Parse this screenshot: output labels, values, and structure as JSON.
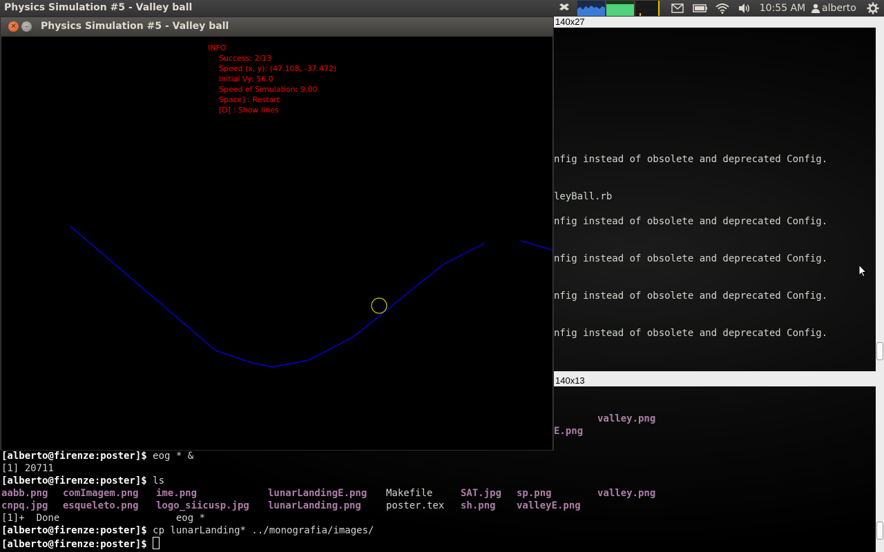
{
  "panel": {
    "app_title": "Physics Simulation #5 - Valley ball",
    "clock": "10:55 AM",
    "user": "alberto",
    "icons": [
      "dropbox-icon",
      "system-monitor-icon",
      "mail-icon",
      "battery-icon",
      "wifi-icon",
      "volume-icon",
      "user-icon",
      "gear-icon"
    ]
  },
  "sim_window": {
    "title": "Physics Simulation #5 - Valley ball",
    "info": {
      "heading": "INFO",
      "success": "Success: 2/13",
      "speed": "Speed (x, y): (47.108, -37.472)",
      "initial_vy": "Initial Vy: 56.0",
      "sim_speed": "Speed of Simulation: 9.00",
      "restart": "Space] : Restart",
      "lines": "[D] : Show lines"
    },
    "colors": {
      "info": "#ff0000",
      "terrain": "#0000ff",
      "ball": "#cccc00"
    }
  },
  "terminal": {
    "pane1": {
      "size_label": "140x27",
      "lines": [
        "nfig instead of obsolete and deprecated Config.",
        "leyBall.rb",
        "nfig instead of obsolete and deprecated Config.",
        "nfig instead of obsolete and deprecated Config.",
        "nfig instead of obsolete and deprecated Config.",
        "nfig instead of obsolete and deprecated Config."
      ]
    },
    "pane2": {
      "size_label": "140x13",
      "file_a": "valley.png",
      "file_b": "E.png"
    },
    "main": {
      "prompt": "[alberto@firenze:poster]$",
      "cmd1": " eog * &",
      "job": "[1] 20711",
      "cmd2": " ls",
      "files_row1": [
        "aabb.png",
        "comImagem.png",
        "ime.png",
        "lunarLandingE.png",
        "Makefile",
        "SAT.jpg",
        "sp.png",
        "valley.png"
      ],
      "files_row2": [
        "cnpq.jpg",
        "esqueleto.png",
        "logo_siicusp.jpg",
        "lunarLanding.png",
        "poster.tex",
        "sh.png",
        "valleyE.png"
      ],
      "done_line": "[1]+  Done                    eog *",
      "cmd3": " cp lunarLanding* ../monografia/images/"
    }
  }
}
